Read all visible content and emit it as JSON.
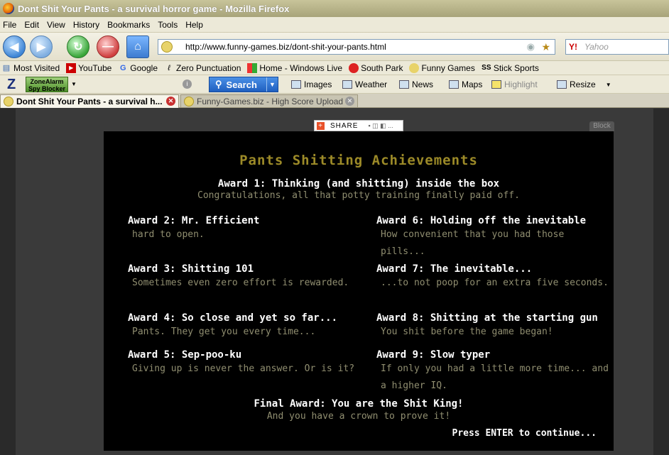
{
  "window": {
    "title": "Dont Shit Your Pants - a survival horror game - Mozilla Firefox"
  },
  "menu": [
    "File",
    "Edit",
    "View",
    "History",
    "Bookmarks",
    "Tools",
    "Help"
  ],
  "nav": {
    "url": "http://www.funny-games.biz/dont-shit-your-pants.html",
    "search_placeholder": "Yahoo",
    "search_engine_icon": "Y!"
  },
  "bookmarks": [
    {
      "label": "Most Visited",
      "icon": "bookmarks-icon"
    },
    {
      "label": "YouTube",
      "icon": "youtube-icon"
    },
    {
      "label": "Google",
      "icon": "google-icon"
    },
    {
      "label": "Zero Punctuation",
      "icon": "zp-icon"
    },
    {
      "label": "Home - Windows Live",
      "icon": "windows-icon"
    },
    {
      "label": "South Park",
      "icon": "southpark-icon"
    },
    {
      "label": "Funny Games",
      "icon": "funnygames-icon"
    },
    {
      "label": "Stick Sports",
      "icon": "ss-icon"
    }
  ],
  "zonealarm": {
    "logo": "Z",
    "spy_blocker_line1": "ZoneAlarm",
    "spy_blocker_line2": "Spy Blocker",
    "search_label": "Search",
    "items": [
      "Images",
      "Weather",
      "News",
      "Maps",
      "Highlight",
      "Resize"
    ]
  },
  "tabs": [
    {
      "label": "Dont Shit Your Pants - a survival h...",
      "active": true
    },
    {
      "label": "Funny-Games.biz - High Score Upload",
      "active": false
    }
  ],
  "page": {
    "share_label": "SHARE",
    "block_label": "Block"
  },
  "game": {
    "title": "Pants Shitting Achievements",
    "award1": {
      "name": "Award 1: Thinking (and shitting) inside the box",
      "desc": "Congratulations, all that potty training finally paid off."
    },
    "left_awards": [
      {
        "name": "Award 2: Mr. Efficient",
        "desc": "hard to open."
      },
      {
        "name": "Award 3: Shitting 101",
        "desc": "Sometimes even zero effort is rewarded."
      },
      {
        "name": "Award 4: So close and yet so far...",
        "desc": "Pants. They get you every time..."
      },
      {
        "name": "Award 5: Sep-poo-ku",
        "desc": "Giving up is never the answer.  Or is it?"
      }
    ],
    "right_awards": [
      {
        "name": "Award 6: Holding off the inevitable",
        "desc": "How convenient that you had those pills..."
      },
      {
        "name": "Award 7: The inevitable...",
        "desc": "...to not poop for an extra five seconds."
      },
      {
        "name": "Award 8: Shitting at the starting gun",
        "desc": "You shit before the game began!"
      },
      {
        "name": "Award 9: Slow typer",
        "desc": "If only you had a little more time... and a higher IQ."
      }
    ],
    "final_award": {
      "name": "Final Award: You are the Shit King!",
      "desc": "And you have a crown to prove it!"
    },
    "continue_prompt": "Press ENTER to continue..."
  }
}
